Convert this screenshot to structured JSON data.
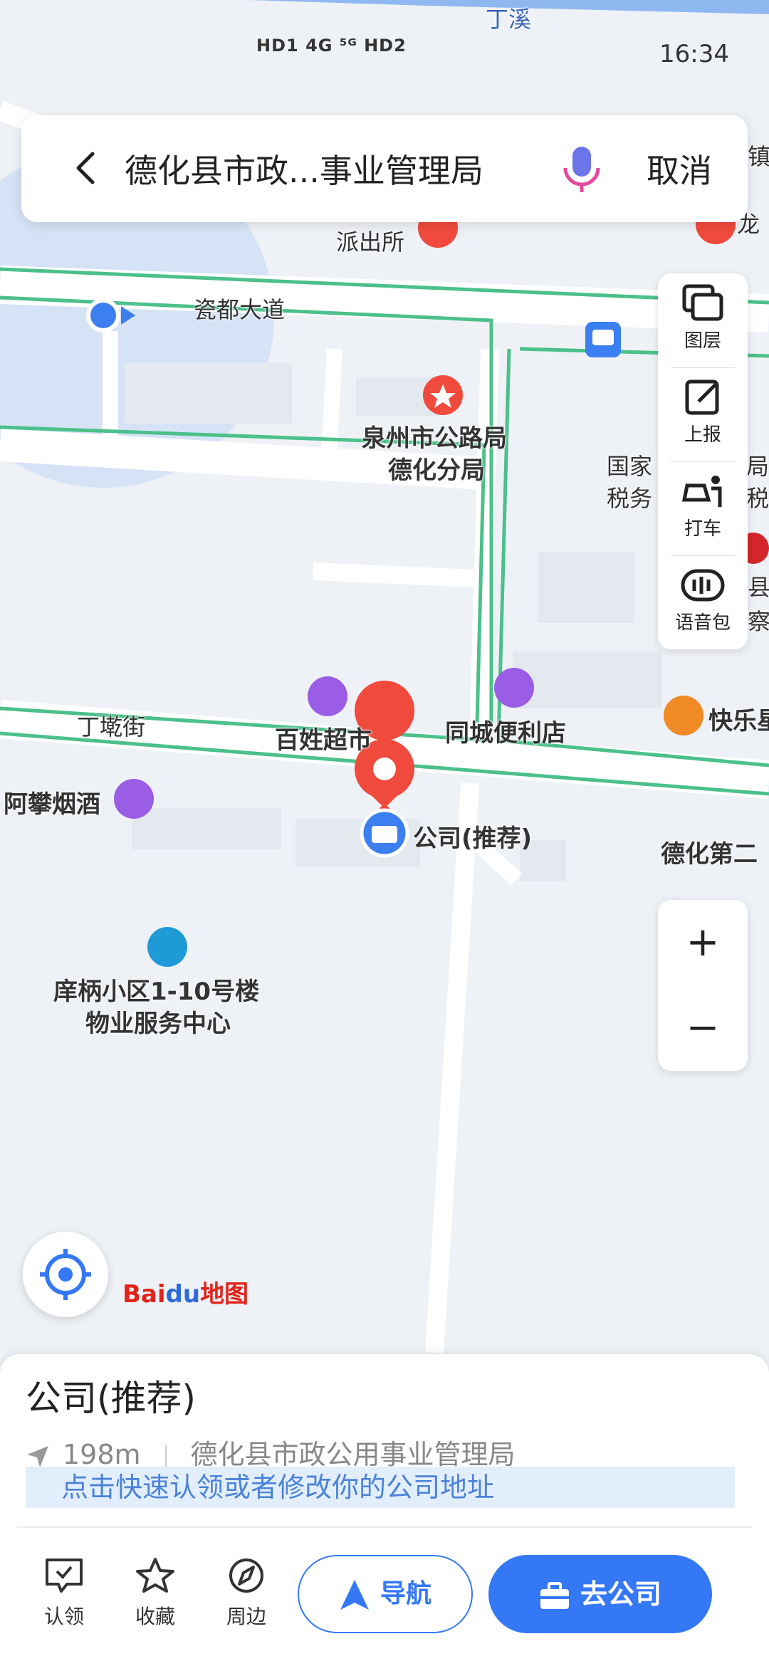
{
  "status_bar": {
    "network_left": "HD1 4G ⁵ᴳ HD2",
    "time": "16:34"
  },
  "search": {
    "query": "德化县市政...事业管理局",
    "cancel_label": "取消"
  },
  "side_panel": {
    "items": [
      {
        "label": "图层",
        "icon": "layers-icon"
      },
      {
        "label": "上报",
        "icon": "report-icon"
      },
      {
        "label": "打车",
        "icon": "taxi-icon"
      },
      {
        "label": "语音包",
        "icon": "voice-pack-icon"
      }
    ]
  },
  "zoom": {
    "in": "+",
    "out": "−"
  },
  "map_labels": {
    "river": "丁溪",
    "town": "镇",
    "dragon": "龙",
    "police": "派出所",
    "road1": "瓷都大道",
    "highway_bureau_1": "泉州市公路局",
    "highway_bureau_2": "德化分局",
    "tax_1": "国家",
    "tax_2": "税务",
    "tax_3": "局",
    "tax_4": "税",
    "county_1": "县",
    "county_2": "察",
    "street": "丁墘街",
    "supermarket": "百姓超市",
    "convenience": "同城便利店",
    "restaurant": "快乐星",
    "tobacco": "阿攀烟酒",
    "company_pin": "公司(推荐)",
    "school": "德化第二",
    "community_1": "庠柄小区1-10号楼",
    "community_2": "物业服务中心"
  },
  "logo": {
    "bai": "Bai",
    "du": "du",
    "map": "地图"
  },
  "place": {
    "title": "公司(推荐)",
    "distance": "198m",
    "address": "德化县市政公用事业管理局",
    "claim_text": "点击快速认领或者修改你的公司地址"
  },
  "actions": {
    "claim": "认领",
    "favorite": "收藏",
    "nearby": "周边",
    "navigate": "导航",
    "go_company": "去公司"
  },
  "colors": {
    "accent": "#3478f6",
    "road_green": "#4cc08a",
    "pin_red": "#f04a3c",
    "poi_purple": "#9b5de5"
  }
}
